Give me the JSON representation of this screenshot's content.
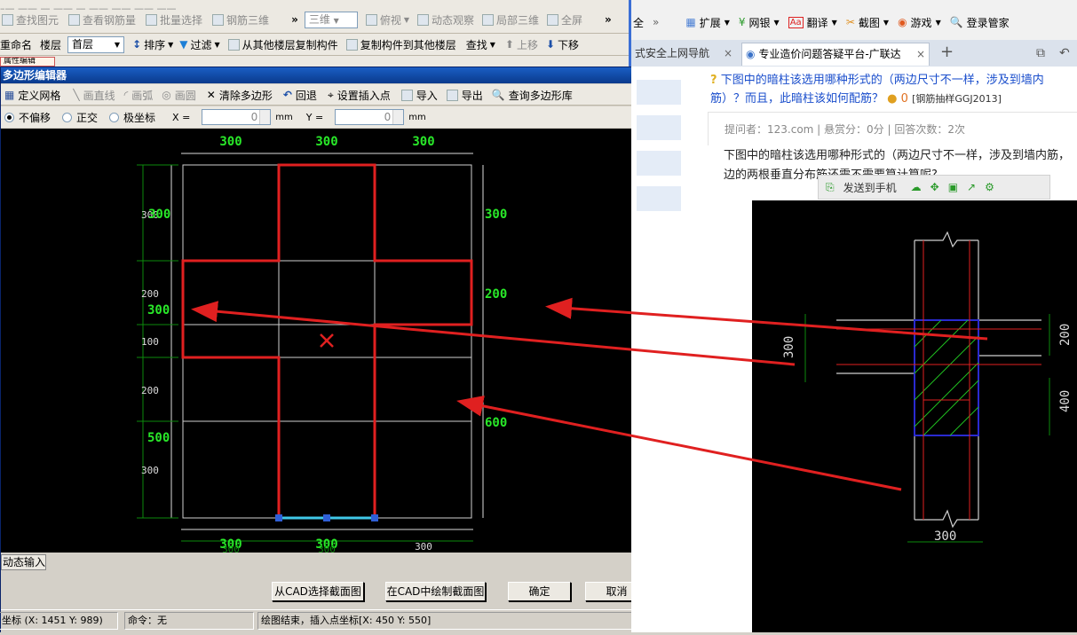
{
  "toolbar1": {
    "items": [
      "查找图元",
      "查看钢筋量",
      "批量选择",
      "钢筋三维"
    ],
    "more": "»",
    "view_select": "三维",
    "view_items": [
      "俯视",
      "动态观察",
      "局部三维",
      "全屏"
    ],
    "more2": "»"
  },
  "toolbar2": {
    "rename_label": "重命名",
    "floor_label": "楼层",
    "floor_value": "首层",
    "sort": "排序",
    "filter": "过滤",
    "copy_from": "从其他楼层复制构件",
    "copy_to": "复制构件到其他楼层",
    "find": "查找",
    "up": "上移",
    "down": "下移"
  },
  "attr_tab": "属性编辑",
  "dialog": {
    "title": "多边形编辑器",
    "close": "✕",
    "tools": [
      "定义网格",
      "画直线",
      "画弧",
      "画圆",
      "清除多边形",
      "回退",
      "设置插入点",
      "导入",
      "导出",
      "查询多边形库"
    ],
    "modes": [
      "不偏移",
      "正交",
      "极坐标"
    ],
    "x_label": "X =",
    "x_value": "0",
    "x_unit": "mm",
    "y_label": "Y =",
    "y_value": "0",
    "y_unit": "mm",
    "dyn_input": "动态输入",
    "buttons": [
      "从CAD选择截面图",
      "在CAD中绘制截面图",
      "确定",
      "取消"
    ],
    "status": {
      "coord": "坐标 (X: 1451 Y: 989)",
      "command": "命令：无",
      "message": "绘图结束，插入点坐标[X: 450 Y: 550]"
    }
  },
  "canvas": {
    "top_dims": [
      "300",
      "300",
      "300"
    ],
    "bottom_dims": [
      "300",
      "300",
      "300"
    ],
    "bottom_ghost": [
      "300",
      "300"
    ],
    "left_dims": [
      "300",
      "200",
      "100",
      "200",
      "300"
    ],
    "left_green": [
      "300",
      "300",
      "500"
    ],
    "right_dims": [
      "300",
      "200",
      "600"
    ]
  },
  "browser": {
    "row1": [
      "全",
      "»",
      "扩展",
      "网银",
      "翻译",
      "截图",
      "游戏",
      "登录管家"
    ],
    "tabs": [
      "式安全上网导航",
      "专业造价问题答疑平台-广联达"
    ],
    "tab_close": "×",
    "new_tab": "+",
    "question_title": "下图中的暗柱该选用哪种形式的（两边尺寸不一样，涉及到墙内筋）？而且，此暗柱该如何配筋？",
    "coin": "0",
    "tag": "[钢筋抽样GGJ2013]",
    "meta": "提问者：123.com   |   悬赏分：0分   |   回答次数：2次",
    "body": "下图中的暗柱该选用哪种形式的（两边尺寸不一样，涉及到墙内筋，边的两根垂直分布筋还需不需要算计算呢?",
    "send_to_phone": "发送到手机",
    "cad_dims": [
      "300",
      "200",
      "400",
      "300"
    ]
  }
}
